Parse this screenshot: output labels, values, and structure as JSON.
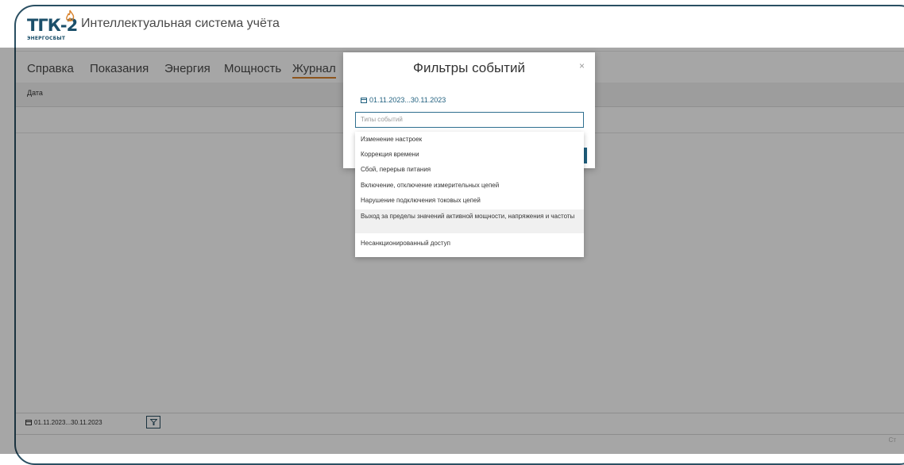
{
  "app": {
    "logo_text": "ТГК-2",
    "logo_subtext": "ЭНЕРГОСБЫТ",
    "title": "Интеллектуальная система учёта"
  },
  "tabs": [
    {
      "label": "Справка"
    },
    {
      "label": "Показания"
    },
    {
      "label": "Энергия"
    },
    {
      "label": "Мощность"
    },
    {
      "label": "Журнал"
    }
  ],
  "grid": {
    "column_date": "Дата"
  },
  "bottom": {
    "date_range": "01.11.2023...30.11.2023",
    "filter_icon": "filter-icon",
    "corner": "Ст"
  },
  "modal": {
    "title": "Фильтры событий",
    "close": "×",
    "date_range": "01.11.2023...30.11.2023",
    "types_placeholder": "Типы событий"
  },
  "event_types": [
    {
      "label": "Изменение настроек"
    },
    {
      "label": "Коррекция времени"
    },
    {
      "label": "Сбой, перерыв питания"
    },
    {
      "label": "Включение, отключение измерительных цепей"
    },
    {
      "label": "Нарушение подключения токовых цепей"
    },
    {
      "label": "Выход за пределы значений активной мощности, напряжения и частоты"
    },
    {
      "label": "Несанкционированный доступ"
    }
  ],
  "colors": {
    "brand": "#1b4f6a",
    "accent": "#d9822b",
    "link": "#1f5f7e"
  }
}
